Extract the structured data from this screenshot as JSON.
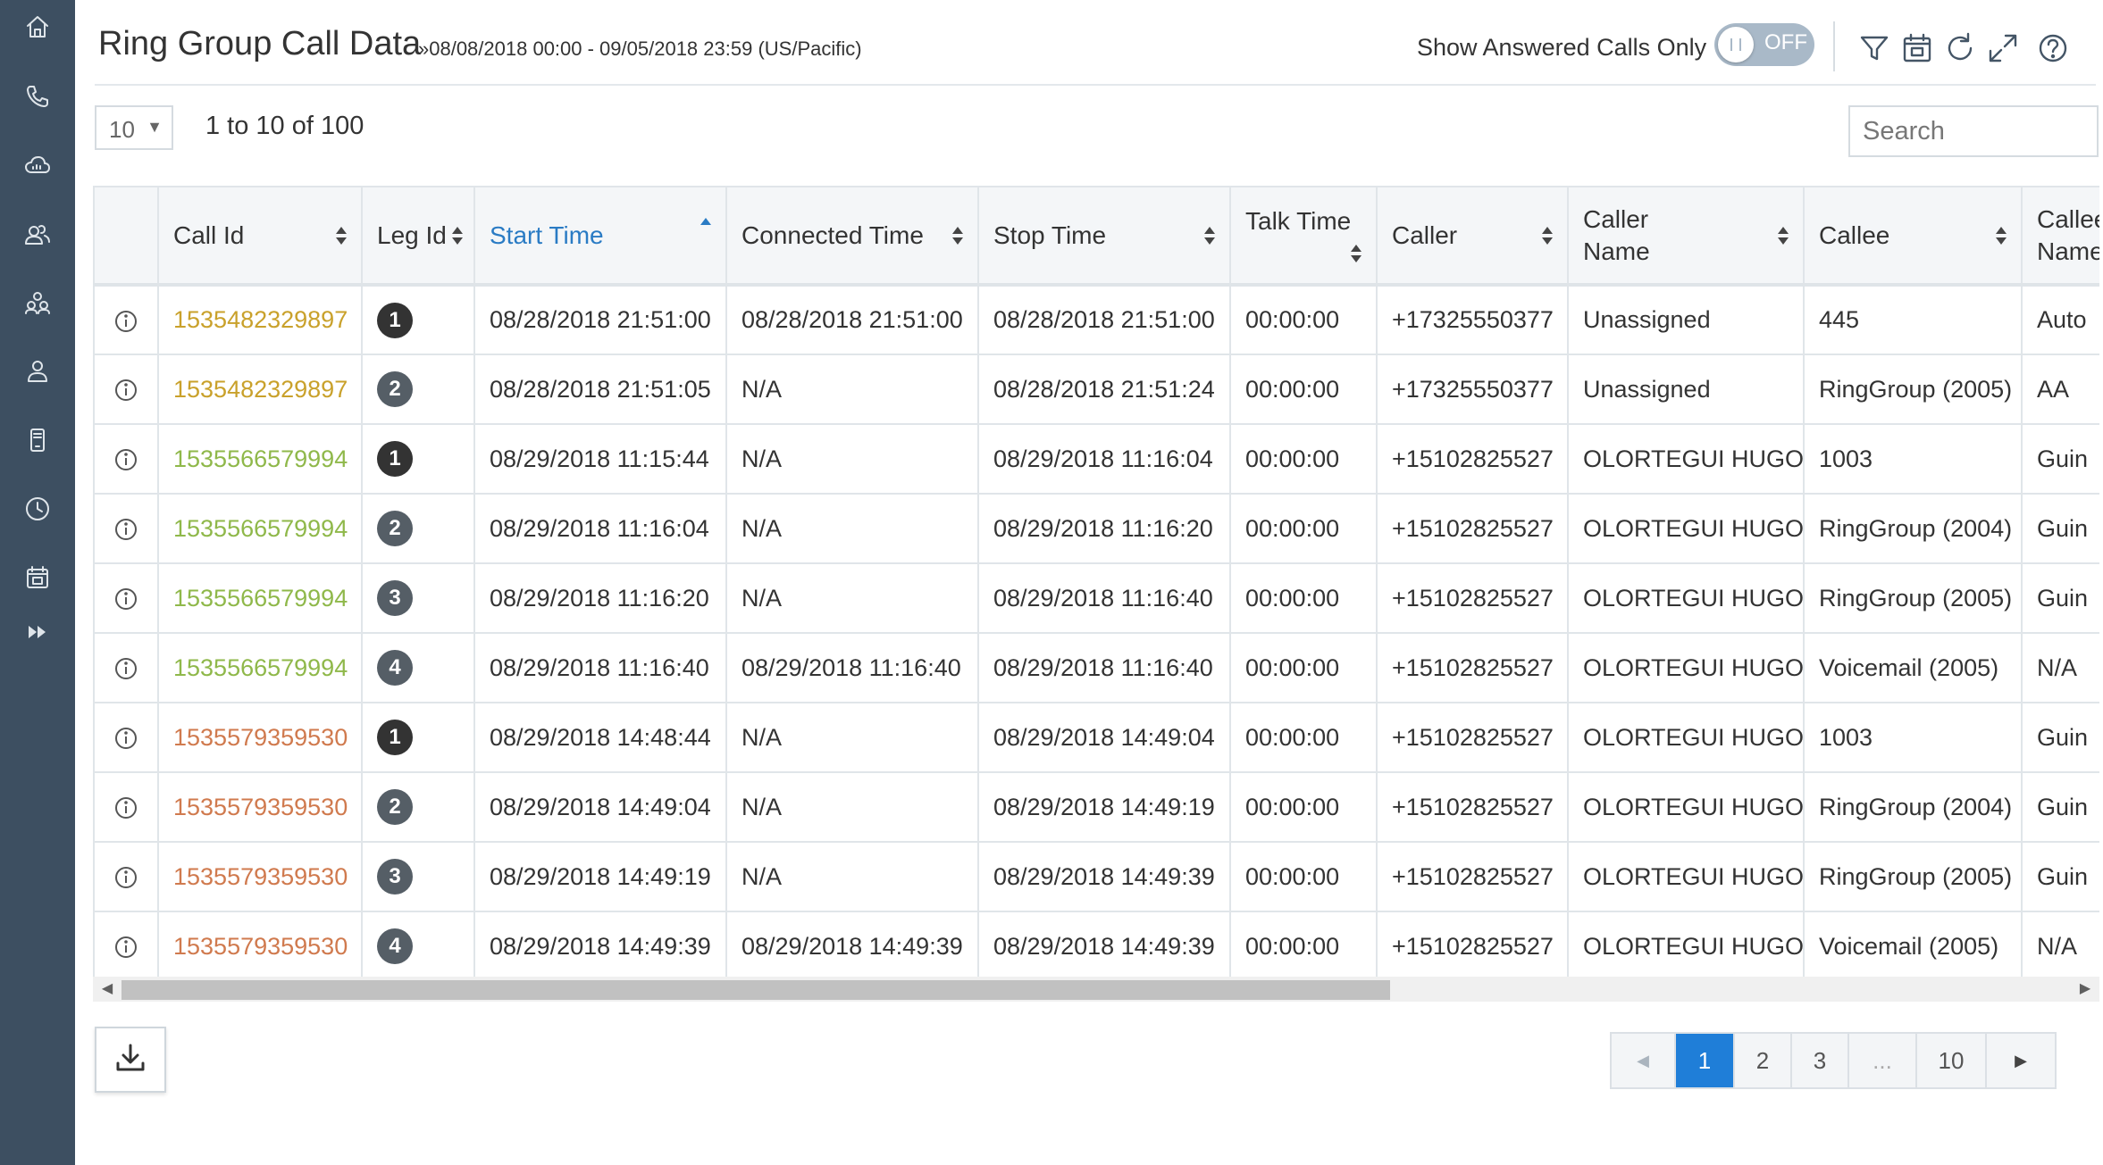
{
  "header": {
    "title": "Ring Group Call Data",
    "date_range": "»08/08/2018 00:00 - 09/05/2018 23:59 (US/Pacific)",
    "toggle_label": "Show Answered Calls Only",
    "toggle_state": "OFF"
  },
  "sidebar": {
    "icons": [
      "home-icon",
      "phone-icon",
      "cloud-icon",
      "users-icon",
      "group-icon",
      "user-icon",
      "device-icon",
      "clock-icon",
      "calendar-icon",
      "expand-icon"
    ]
  },
  "toolbar": {
    "icons": [
      "filter-icon",
      "calendar-icon",
      "refresh-icon",
      "fullscreen-icon",
      "help-icon"
    ]
  },
  "controls": {
    "page_size": "10",
    "range_text": "1 to 10 of 100",
    "search_placeholder": "Search"
  },
  "table": {
    "columns": [
      "",
      "Call Id",
      "Leg Id",
      "Start Time",
      "Connected Time",
      "Stop Time",
      "Talk Time",
      "Caller",
      "Caller Name",
      "Callee",
      "Callee Name"
    ],
    "sorted_column": "Start Time",
    "rows": [
      {
        "call_id": "1535482329897",
        "call_id_color": "#c9a12b",
        "leg": "1",
        "start": "08/28/2018 21:51:00",
        "connected": "08/28/2018 21:51:00",
        "stop": "08/28/2018 21:51:00",
        "talk": "00:00:00",
        "caller": "+17325550377",
        "caller_name": "Unassigned",
        "callee": "445",
        "callee_name": "Auto"
      },
      {
        "call_id": "1535482329897",
        "call_id_color": "#c9a12b",
        "leg": "2",
        "start": "08/28/2018 21:51:05",
        "connected": "N/A",
        "stop": "08/28/2018 21:51:24",
        "talk": "00:00:00",
        "caller": "+17325550377",
        "caller_name": "Unassigned",
        "callee": "RingGroup (2005)",
        "callee_name": "AA"
      },
      {
        "call_id": "1535566579994",
        "call_id_color": "#8fb84a",
        "leg": "1",
        "start": "08/29/2018 11:15:44",
        "connected": "N/A",
        "stop": "08/29/2018 11:16:04",
        "talk": "00:00:00",
        "caller": "+15102825527",
        "caller_name": "OLORTEGUI HUGO",
        "callee": "1003",
        "callee_name": "Guin"
      },
      {
        "call_id": "1535566579994",
        "call_id_color": "#8fb84a",
        "leg": "2",
        "start": "08/29/2018 11:16:04",
        "connected": "N/A",
        "stop": "08/29/2018 11:16:20",
        "talk": "00:00:00",
        "caller": "+15102825527",
        "caller_name": "OLORTEGUI HUGO",
        "callee": "RingGroup (2004)",
        "callee_name": "Guin"
      },
      {
        "call_id": "1535566579994",
        "call_id_color": "#8fb84a",
        "leg": "3",
        "start": "08/29/2018 11:16:20",
        "connected": "N/A",
        "stop": "08/29/2018 11:16:40",
        "talk": "00:00:00",
        "caller": "+15102825527",
        "caller_name": "OLORTEGUI HUGO",
        "callee": "RingGroup (2005)",
        "callee_name": "Guin"
      },
      {
        "call_id": "1535566579994",
        "call_id_color": "#8fb84a",
        "leg": "4",
        "start": "08/29/2018 11:16:40",
        "connected": "08/29/2018 11:16:40",
        "stop": "08/29/2018 11:16:40",
        "talk": "00:00:00",
        "caller": "+15102825527",
        "caller_name": "OLORTEGUI HUGO",
        "callee": "Voicemail (2005)",
        "callee_name": "N/A"
      },
      {
        "call_id": "1535579359530",
        "call_id_color": "#d07a4e",
        "leg": "1",
        "start": "08/29/2018 14:48:44",
        "connected": "N/A",
        "stop": "08/29/2018 14:49:04",
        "talk": "00:00:00",
        "caller": "+15102825527",
        "caller_name": "OLORTEGUI HUGO",
        "callee": "1003",
        "callee_name": "Guin"
      },
      {
        "call_id": "1535579359530",
        "call_id_color": "#d07a4e",
        "leg": "2",
        "start": "08/29/2018 14:49:04",
        "connected": "N/A",
        "stop": "08/29/2018 14:49:19",
        "talk": "00:00:00",
        "caller": "+15102825527",
        "caller_name": "OLORTEGUI HUGO",
        "callee": "RingGroup (2004)",
        "callee_name": "Guin"
      },
      {
        "call_id": "1535579359530",
        "call_id_color": "#d07a4e",
        "leg": "3",
        "start": "08/29/2018 14:49:19",
        "connected": "N/A",
        "stop": "08/29/2018 14:49:39",
        "talk": "00:00:00",
        "caller": "+15102825527",
        "caller_name": "OLORTEGUI HUGO",
        "callee": "RingGroup (2005)",
        "callee_name": "Guin"
      },
      {
        "call_id": "1535579359530",
        "call_id_color": "#d07a4e",
        "leg": "4",
        "start": "08/29/2018 14:49:39",
        "connected": "08/29/2018 14:49:39",
        "stop": "08/29/2018 14:49:39",
        "talk": "00:00:00",
        "caller": "+15102825527",
        "caller_name": "OLORTEGUI HUGO",
        "callee": "Voicemail (2005)",
        "callee_name": "N/A"
      }
    ]
  },
  "pagination": {
    "pages": [
      "1",
      "2",
      "3",
      "...",
      "10"
    ],
    "active": "1"
  },
  "colors": {
    "sidebar": "#3d4f61",
    "accent": "#1f7ed8",
    "sorted_header": "#2a7bc4",
    "leg_badge_dark": "#333333",
    "leg_badge_gray": "#555e66"
  }
}
